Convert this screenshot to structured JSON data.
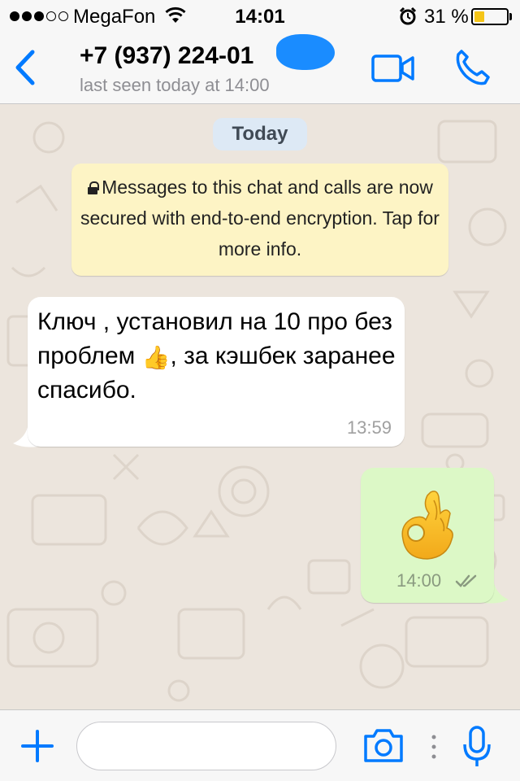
{
  "status_bar": {
    "carrier": "MegaFon",
    "time": "14:01",
    "battery_percent_label": "31 %",
    "battery_level": 0.31,
    "signal_bars_filled": 3,
    "signal_bars_total": 5,
    "icons": [
      "wifi-icon",
      "alarm-icon",
      "battery-icon"
    ]
  },
  "header": {
    "contact_name": "+7 (937) 224-01",
    "last_seen": "last seen today at 14:00",
    "icons": [
      "back-chevron-icon",
      "video-camera-icon",
      "phone-icon"
    ]
  },
  "chat": {
    "date_label": "Today",
    "encryption_notice": "Messages to this chat and calls are now secured with end-to-end encryption. Tap for more info.",
    "messages": [
      {
        "direction": "incoming",
        "text_before_emoji": "Ключ , установил на 10 про без проблем ",
        "emoji": "👍",
        "text_after_emoji": ", за кэшбек заранее спасибо.",
        "time": "13:59"
      },
      {
        "direction": "outgoing",
        "emoji": "ok-hand-emoji",
        "time": "14:00",
        "status": "read"
      }
    ]
  },
  "input_bar": {
    "placeholder": "",
    "icons": [
      "plus-icon",
      "camera-icon",
      "more-dots-icon",
      "microphone-icon"
    ]
  },
  "colors": {
    "accent": "#007aff",
    "incoming_bubble": "#ffffff",
    "outgoing_bubble": "#dcf8c6",
    "notice_bg": "#fdf4c5",
    "date_chip_bg": "#dde9f5",
    "chat_bg": "#ece5dd",
    "redaction": "#1a8cff"
  }
}
